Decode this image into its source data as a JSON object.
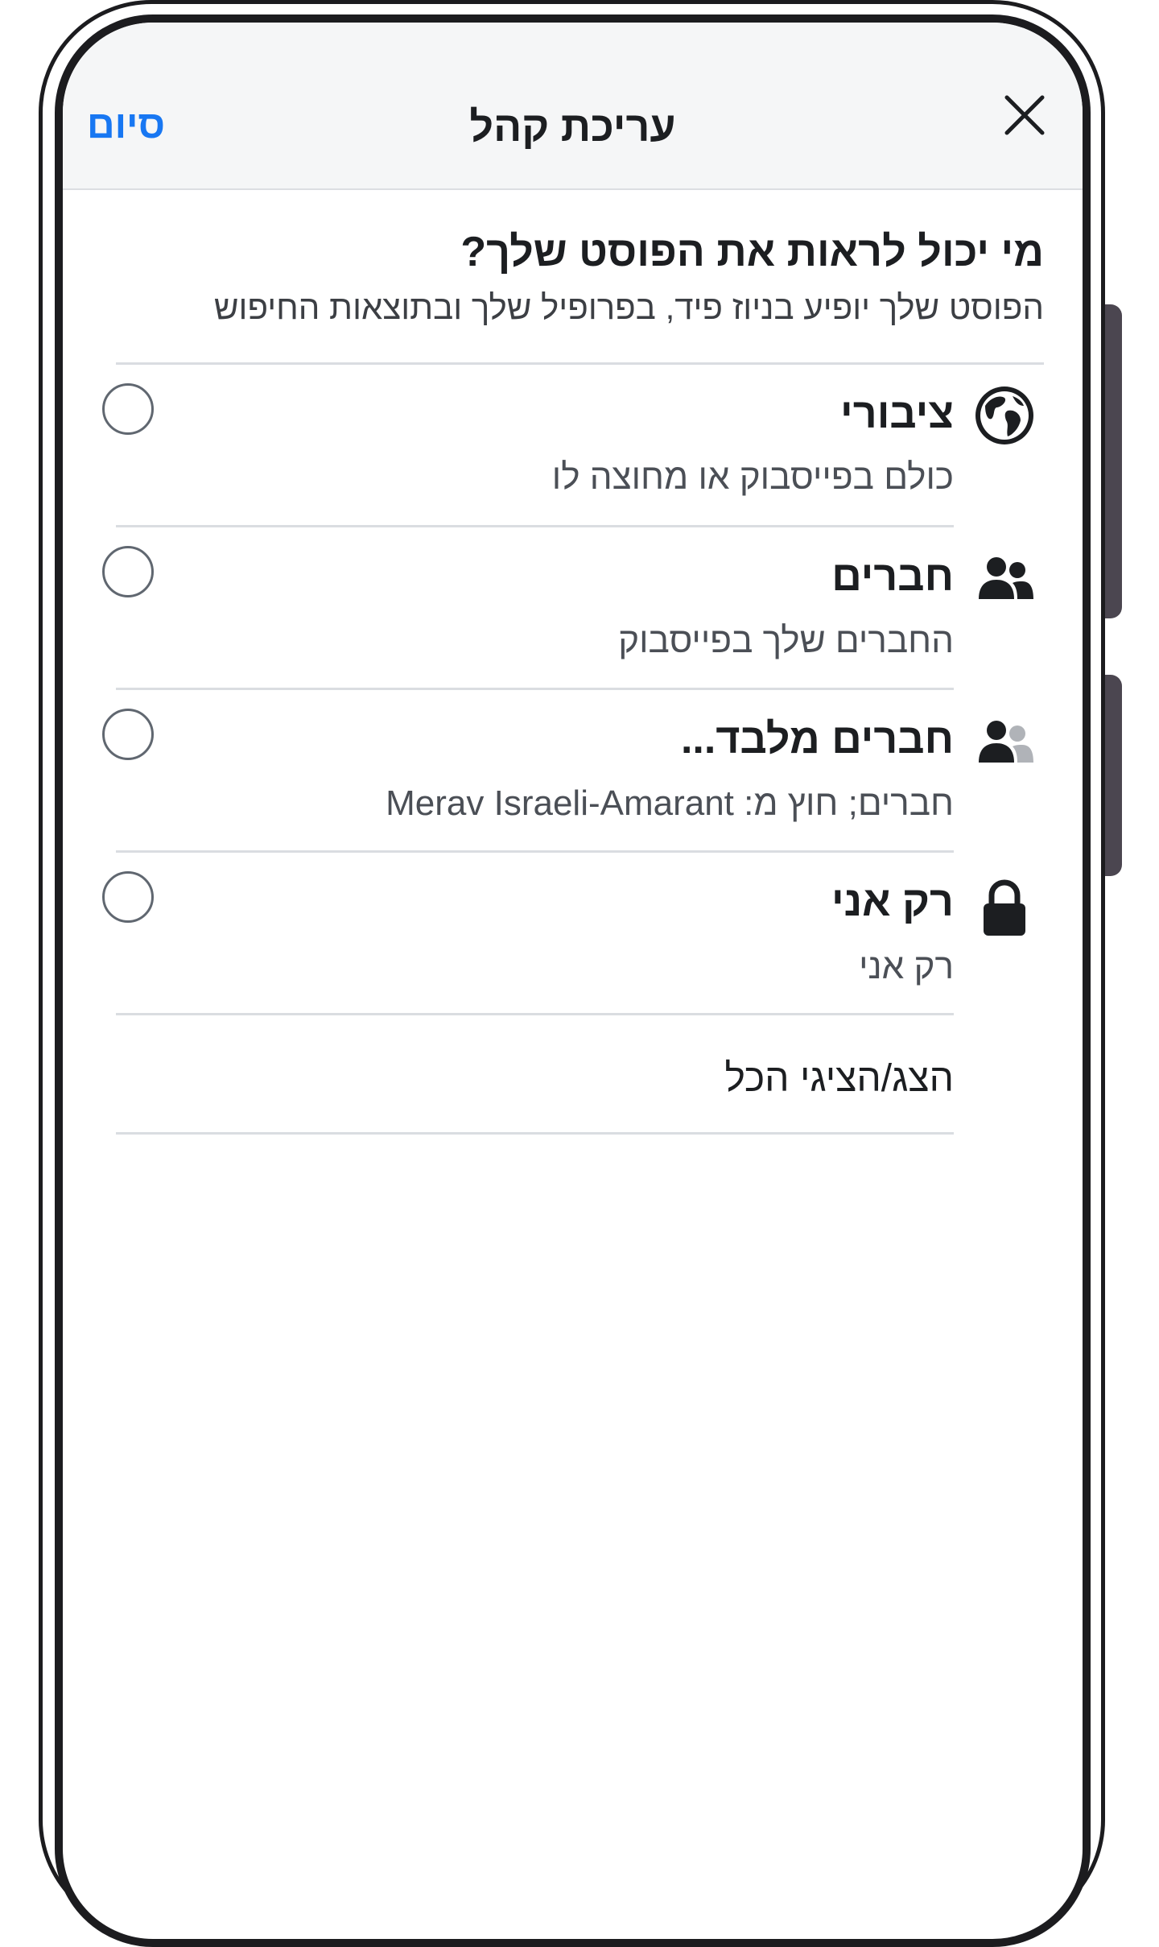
{
  "header": {
    "title": "עריכת קהל",
    "done_label": "סיום",
    "close_icon": "close-icon"
  },
  "question": {
    "title": "מי יכול לראות את הפוסט שלך?",
    "subtitle": "הפוסט שלך יופיע בניוז פיד, בפרופיל שלך ובתוצאות החיפוש"
  },
  "options": [
    {
      "icon": "globe-icon",
      "title": "ציבורי",
      "subtitle": "כולם בפייסבוק או מחוצה לו",
      "selected": false
    },
    {
      "icon": "friends-icon",
      "title": "חברים",
      "subtitle": "החברים שלך בפייסבוק",
      "selected": false
    },
    {
      "icon": "friends-except-icon",
      "title": "חברים מלבד...",
      "subtitle": "חברים; חוץ מ: Merav Israeli-Amarant",
      "selected": false
    },
    {
      "icon": "lock-icon",
      "title": "רק אני",
      "subtitle": "רק אני",
      "selected": false
    }
  ],
  "show_all_label": "הצג/הציגי הכל",
  "colors": {
    "accent": "#1877f2",
    "header_bg": "#f5f6f7",
    "text_primary": "#1c1e21",
    "text_secondary": "#4b4f56",
    "divider": "#dadde1",
    "frame": "#1c1c1f"
  }
}
